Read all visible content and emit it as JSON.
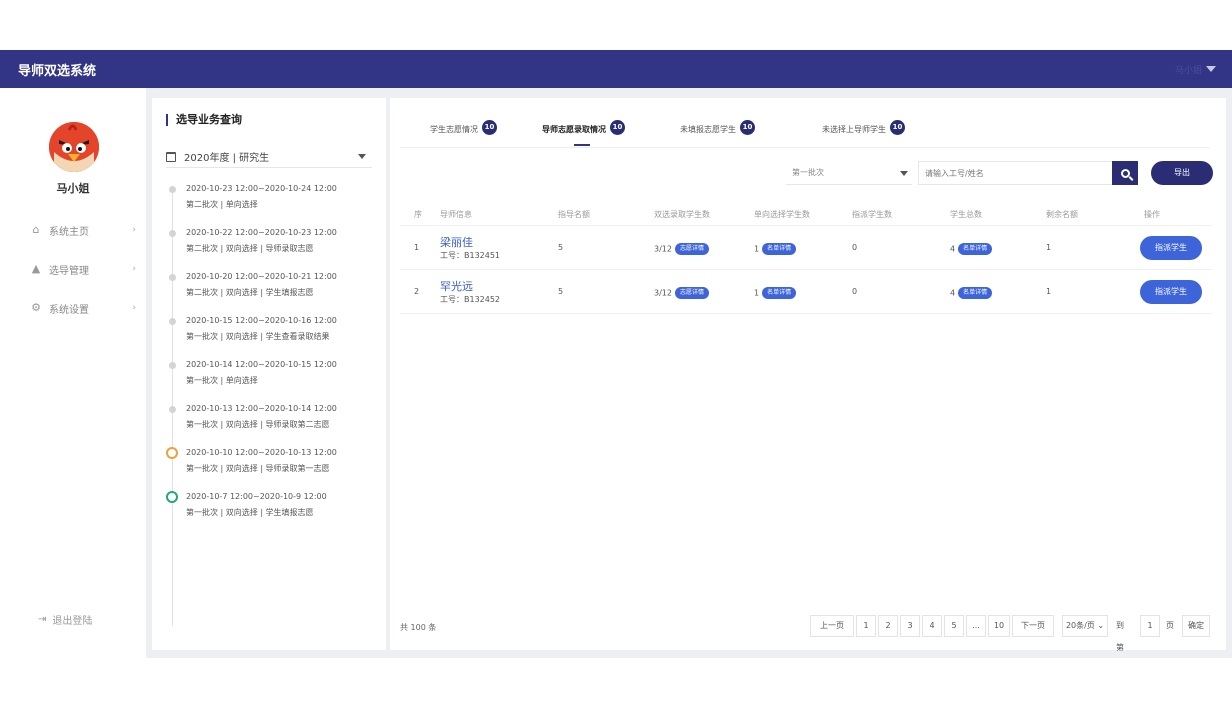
{
  "header": {
    "title": "导师双选系统",
    "user_label": "马小姐"
  },
  "sidebar": {
    "user_name": "马小姐",
    "items": [
      {
        "label": "系统主页",
        "icon": "home-icon"
      },
      {
        "label": "选导管理",
        "icon": "graduation-cap-icon"
      },
      {
        "label": "系统设置",
        "icon": "gear-icon"
      }
    ],
    "logout_label": "退出登陆"
  },
  "left_panel": {
    "title": "选导业务查询",
    "year_select": "2020年度 | 研究生",
    "timeline": [
      {
        "time": "2020-10-23 12:00~2020-10-24 12:00",
        "desc": "第二批次 | 单向选择",
        "status": "grey"
      },
      {
        "time": "2020-10-22 12:00~2020-10-23 12:00",
        "desc": "第二批次 | 双向选择 | 导师录取志愿",
        "status": "grey"
      },
      {
        "time": "2020-10-20 12:00~2020-10-21 12:00",
        "desc": "第二批次 | 双向选择 | 学生填报志愿",
        "status": "grey"
      },
      {
        "time": "2020-10-15 12:00~2020-10-16 12:00",
        "desc": "第一批次 | 双向选择 | 学生查看录取结果",
        "status": "grey"
      },
      {
        "time": "2020-10-14 12:00~2020-10-15 12:00",
        "desc": "第一批次 | 单向选择",
        "status": "grey"
      },
      {
        "time": "2020-10-13 12:00~2020-10-14 12:00",
        "desc": "第一批次 | 双向选择 | 导师录取第二志愿",
        "status": "grey"
      },
      {
        "time": "2020-10-10 12:00~2020-10-13 12:00",
        "desc": "第一批次 | 双向选择 | 导师录取第一志愿",
        "status": "orange"
      },
      {
        "time": "2020-10-7 12:00~2020-10-9 12:00",
        "desc": "第一批次 | 双向选择 | 学生填报志愿",
        "status": "green"
      }
    ]
  },
  "main": {
    "tabs": [
      {
        "label": "学生志愿情况",
        "count": "10"
      },
      {
        "label": "导师志愿录取情况",
        "count": "10"
      },
      {
        "label": "未填报志愿学生",
        "count": "10"
      },
      {
        "label": "未选择上导师学生",
        "count": "10"
      }
    ],
    "batch_select": "第一批次",
    "search_placeholder": "请输入工号/姓名",
    "export_label": "导出",
    "columns": [
      "序",
      "导师信息",
      "指导名额",
      "双选录取学生数",
      "单向选择学生数",
      "指派学生数",
      "学生总数",
      "剩余名额",
      "操作"
    ],
    "rows": [
      {
        "index": "1",
        "name": "梁丽佳",
        "staff_id": "工号：B132451",
        "quota": "5",
        "two_way": "3/12",
        "two_way_badge": "志愿详情",
        "one_way": "1",
        "one_way_badge": "名单详情",
        "assigned": "0",
        "total": "4",
        "total_badge": "名单详情",
        "remaining": "1",
        "action": "指派学生"
      },
      {
        "index": "2",
        "name": "罕光远",
        "staff_id": "工号：B132452",
        "quota": "5",
        "two_way": "3/12",
        "two_way_badge": "志愿详情",
        "one_way": "1",
        "one_way_badge": "名单详情",
        "assigned": "0",
        "total": "4",
        "total_badge": "名单详情",
        "remaining": "1",
        "action": "指派学生"
      }
    ],
    "total_text": "共 100 条",
    "pagination": {
      "prev": "上一页",
      "pages": [
        "1",
        "2",
        "3",
        "4",
        "5",
        "...",
        "10"
      ],
      "next": "下一页",
      "page_size": "20条/页",
      "goto_label": "到第",
      "goto_value": "1",
      "page_unit": "页",
      "confirm": "确定"
    }
  },
  "colors": {
    "header_bg": "#323586",
    "accent": "#3d64d8",
    "badge_dark": "#2a2d74",
    "timeline_orange": "#f0a03c",
    "timeline_green": "#1fa97a"
  }
}
